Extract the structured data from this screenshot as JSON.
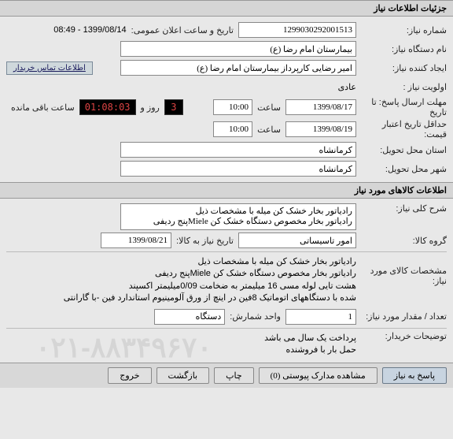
{
  "section1_title": "جزئیات اطلاعات نیاز",
  "need_number_label": "شماره نیاز:",
  "need_number": "1299030292001513",
  "public_date_label": "تاریخ و ساعت اعلان عمومی:",
  "public_date": "1399/08/14 - 08:49",
  "device_name_label": "نام دستگاه نیاز:",
  "device_name": "بیمارستان امام رضا (ع)",
  "creator_label": "ایجاد کننده نیاز:",
  "creator": "امیر رضایی کارپرداز بیمارستان امام رضا (ع)",
  "buyer_contact_btn": "اطلاعات تماس خریدار",
  "priority_label": "اولویت نیاز :",
  "priority": "عادی",
  "response_deadline_label": "مهلت ارسال پاسخ:  تا تاریخ",
  "response_date": "1399/08/17",
  "time_label": "ساعت",
  "response_time": "10:00",
  "days_remain": "3",
  "days_label": "روز و",
  "timer": "01:08:03",
  "remaining_label": "ساعت باقی مانده",
  "price_validity_label": "حداقل تاریخ اعتبار قیمت:",
  "price_validity_date": "1399/08/19",
  "price_validity_time": "10:00",
  "delivery_state_label": "استان محل تحویل:",
  "delivery_state": "کرمانشاه",
  "delivery_city_label": "شهر محل تحویل:",
  "delivery_city": "کرمانشاه",
  "section2_title": "اطلاعات کالاهای مورد نیاز",
  "general_desc_label": "شرح کلی نیاز:",
  "general_desc": "رادیاتور بخار خشک کن میله با مشخصات ذیل\nرادیاتور بخار مخصوص دستگاه خشک کن Mieleپنج ردیفی",
  "goods_group_label": "گروه کالا:",
  "goods_group": "امور تاسیساتی",
  "goods_date_label": "تاریخ نیاز به کالا:",
  "goods_date": "1399/08/21",
  "goods_spec_label": "مشخصات کالای مورد نیاز:",
  "goods_spec": "رادیاتور بخار خشک کن میله با مشخصات ذیل\nرادیاتور بخار مخصوص دستگاه خشک کن Mieleپنج ردیفی\nهشت تایی لوله مسی 16 میلیمتر به ضخامت 0/09میلیمتر اکسپند\nشده با دستگاههای اتوماتیک 8فین در اینچ از ورق آلومینیوم استاندارد فین -با گارانتی",
  "qty_label": "تعداد / مقدار مورد نیاز:",
  "qty": "1",
  "unit_label": "واحد شمارش:",
  "unit": "دستگاه",
  "buyer_notes_label": "توضیحات خریدار:",
  "buyer_notes": "پرداخت یک سال می باشد\nحمل بار با فروشنده",
  "btn_respond": "پاسخ به نیاز",
  "btn_attachments": "مشاهده مدارک پیوستی (0)",
  "btn_print": "چاپ",
  "btn_back": "بازگشت",
  "btn_exit": "خروج",
  "watermark": "۰۲۱-۸۸۳۴۹۶۷۰"
}
